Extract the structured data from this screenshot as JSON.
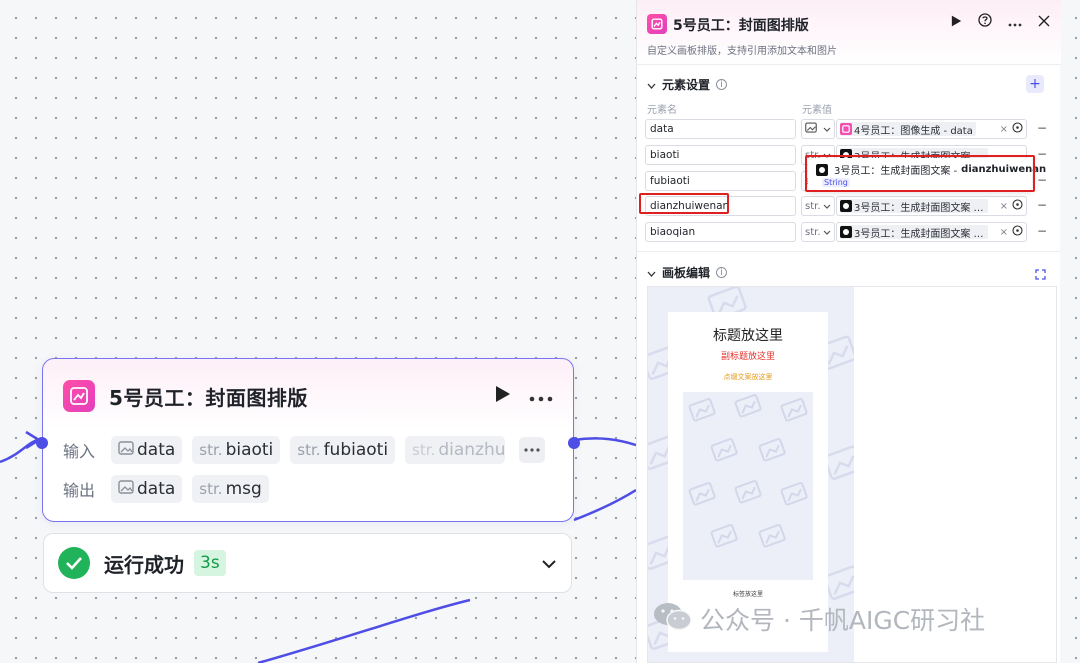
{
  "node": {
    "title": "5号员工：封面图排版",
    "input_label": "输入",
    "output_label": "输出",
    "inputs": [
      {
        "type": "",
        "name": "data"
      },
      {
        "type": "str.",
        "name": "biaoti"
      },
      {
        "type": "str.",
        "name": "fubiaoti"
      },
      {
        "type": "str.",
        "name": "dianzhu"
      }
    ],
    "outputs": [
      {
        "type": "",
        "name": "data"
      },
      {
        "type": "str.",
        "name": "msg"
      }
    ]
  },
  "status": {
    "text": "运行成功",
    "time": "3s"
  },
  "panel": {
    "title": "5号员工：封面图排版",
    "description": "自定义画板排版，支持引用添加文本和图片",
    "elements_section": "元素设置",
    "col_name": "元素名",
    "col_value": "元素值",
    "rows": [
      {
        "name": "data",
        "type": "",
        "value": "4号员工：图像生成 - data"
      },
      {
        "name": "biaoti",
        "type": "str.",
        "value": "3号员工：生成封面图文案 - biaoti"
      },
      {
        "name": "fubiaoti",
        "type": "str.",
        "value": ""
      },
      {
        "name": "dianzhuiwenan",
        "type": "str.",
        "value": "3号员工：生成封面图文案 - dia…"
      },
      {
        "name": "biaoqian",
        "type": "str.",
        "value": "3号员工：生成封面图文案 - bia…"
      }
    ],
    "tooltip": {
      "source": "3号员工：生成封面图文案 - ",
      "field": "dianzhuiwenan",
      "type": "String"
    },
    "canvas_section": "画板编辑",
    "canvas": {
      "title": "标题放这里",
      "subtitle": "副标题放这里",
      "note": "点缀文案放这里",
      "tag": "标签放这里"
    }
  },
  "watermark": "公众号 · 千帆AIGC研习社",
  "colors": {
    "accent": "#4e4ee6",
    "success": "#21b35a",
    "highlight": "#e02020",
    "brand_pink": "#e23ebf"
  }
}
